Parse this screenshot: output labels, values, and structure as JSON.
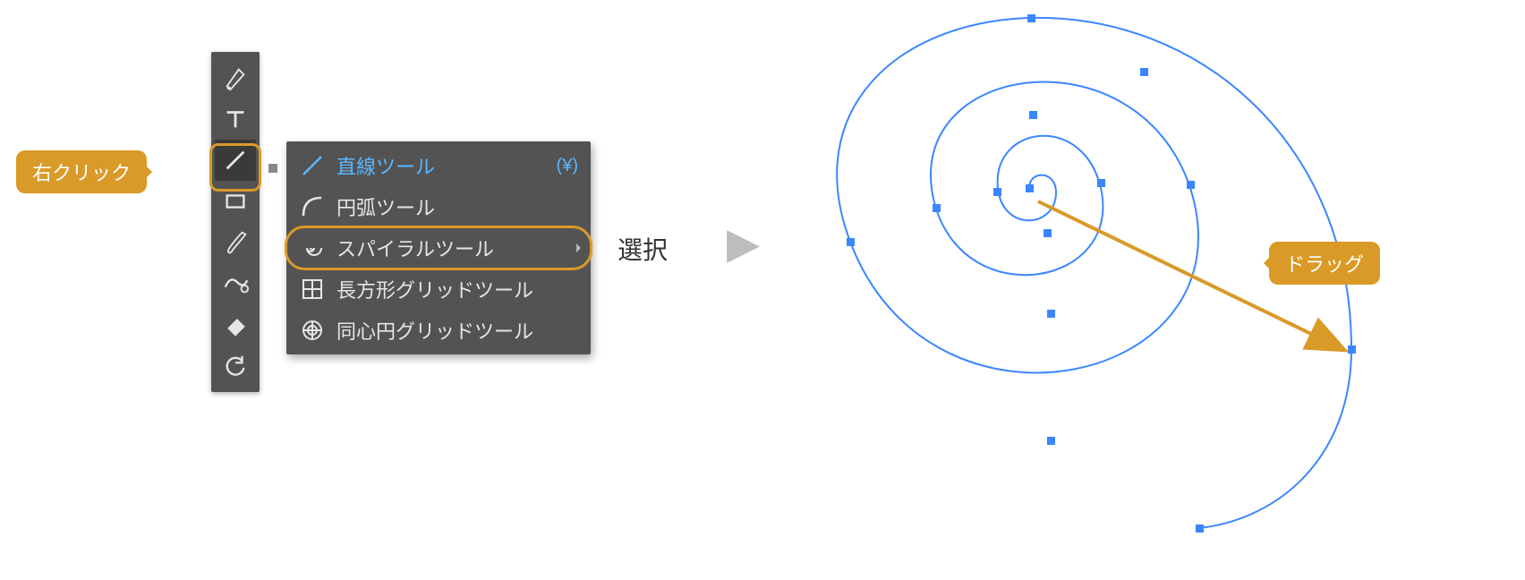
{
  "callouts": {
    "right_click": "右クリック",
    "drag": "ドラッグ"
  },
  "toolbar": {
    "tools": [
      {
        "name": "pen-tool-icon"
      },
      {
        "name": "type-tool-icon"
      },
      {
        "name": "line-segment-tool-icon"
      },
      {
        "name": "rectangle-tool-icon"
      },
      {
        "name": "paintbrush-tool-icon"
      },
      {
        "name": "shaper-tool-icon"
      },
      {
        "name": "eraser-tool-icon"
      },
      {
        "name": "rotate-tool-icon"
      }
    ]
  },
  "flyout": {
    "items": [
      {
        "label": "直線ツール",
        "shortcut": "(¥)",
        "active": true,
        "icon": "line-icon"
      },
      {
        "label": "円弧ツール",
        "shortcut": "",
        "active": false,
        "icon": "arc-icon"
      },
      {
        "label": "スパイラルツール",
        "shortcut": "",
        "active": false,
        "icon": "spiral-icon",
        "submenu": true
      },
      {
        "label": "長方形グリッドツール",
        "shortcut": "",
        "active": false,
        "icon": "rect-grid-icon"
      },
      {
        "label": "同心円グリッドツール",
        "shortcut": "",
        "active": false,
        "icon": "polar-grid-icon"
      }
    ]
  },
  "labels": {
    "select": "選択"
  },
  "colors": {
    "accent": "#d99a27",
    "spiral_stroke": "#3a86ff",
    "anchor_fill": "#3a86ff"
  }
}
